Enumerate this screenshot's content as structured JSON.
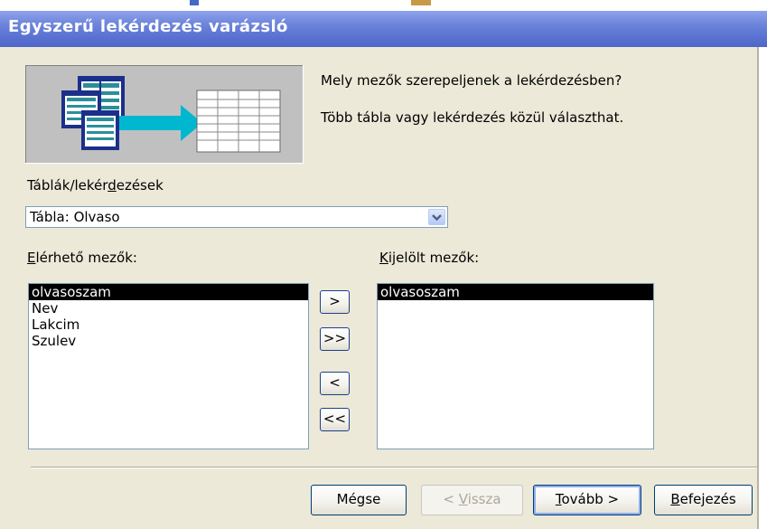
{
  "window": {
    "title": "Egyszerű lekérdezés varázsló"
  },
  "intro": {
    "question": "Mely mezők szerepeljenek a lekérdezésben?",
    "hint": "Több tábla vagy lekérdezés közül választhat."
  },
  "tables": {
    "label_pre": "Táblák/lekér",
    "label_key": "d",
    "label_post": "ezések",
    "selected": "Tábla: Olvaso"
  },
  "available": {
    "label_key": "E",
    "label_post": "lérhető mezők:",
    "items": [
      "olvasoszam",
      "Nev",
      "Lakcim",
      "Szulev"
    ],
    "selected_index": 0
  },
  "chosen": {
    "label_key": "K",
    "label_post": "ijelölt mezők:",
    "items": [
      "olvasoszam"
    ],
    "selected_index": 0
  },
  "move_buttons": {
    "add_one": ">",
    "add_all": ">>",
    "remove_one": "<",
    "remove_all": "<<"
  },
  "footer": {
    "cancel": "Mégse",
    "back_pre": "< ",
    "back_key": "V",
    "back_post": "issza",
    "next_key": "T",
    "next_post": "ovább >",
    "finish_key": "B",
    "finish_post": "efejezés"
  },
  "colors": {
    "title_bar": "#6f86dc",
    "dialog_bg": "#ece9d8",
    "list_selection": "#000000",
    "arrow": "#00b7d0"
  }
}
